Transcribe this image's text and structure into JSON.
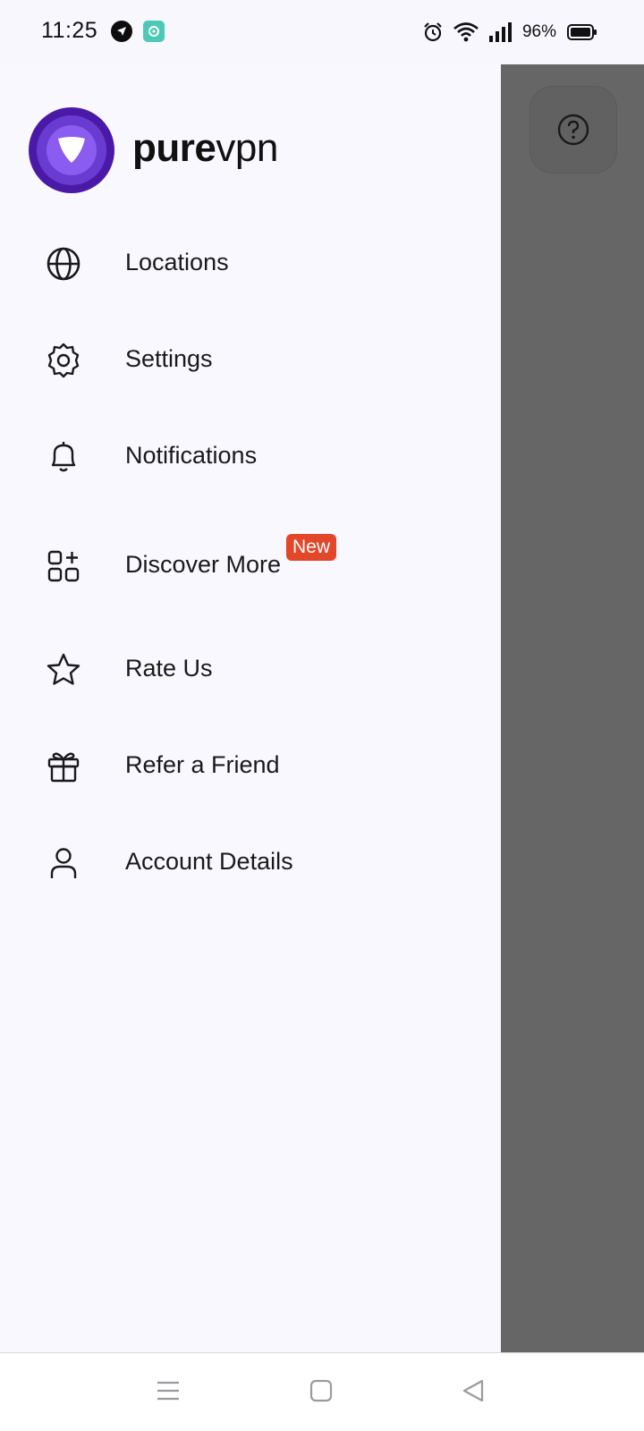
{
  "status_bar": {
    "time": "11:25",
    "battery": "96%",
    "icons": [
      "telegram-icon",
      "app-icon",
      "alarm-icon",
      "wifi-icon",
      "signal-icon",
      "battery-icon"
    ]
  },
  "brand": {
    "name_bold": "pure",
    "name_light": "vpn"
  },
  "menu": [
    {
      "label": "Locations",
      "icon": "globe-icon"
    },
    {
      "label": "Settings",
      "icon": "gear-icon"
    },
    {
      "label": "Notifications",
      "icon": "bell-icon"
    },
    {
      "label": "Discover More",
      "icon": "grid-plus-icon",
      "badge": "New"
    },
    {
      "label": "Rate Us",
      "icon": "star-icon"
    },
    {
      "label": "Refer a Friend",
      "icon": "gift-icon"
    },
    {
      "label": "Account Details",
      "icon": "user-icon"
    }
  ],
  "colors": {
    "brand_purple": "#4a1aa6",
    "badge_red": "#e2472a",
    "scrim": "#666666"
  }
}
